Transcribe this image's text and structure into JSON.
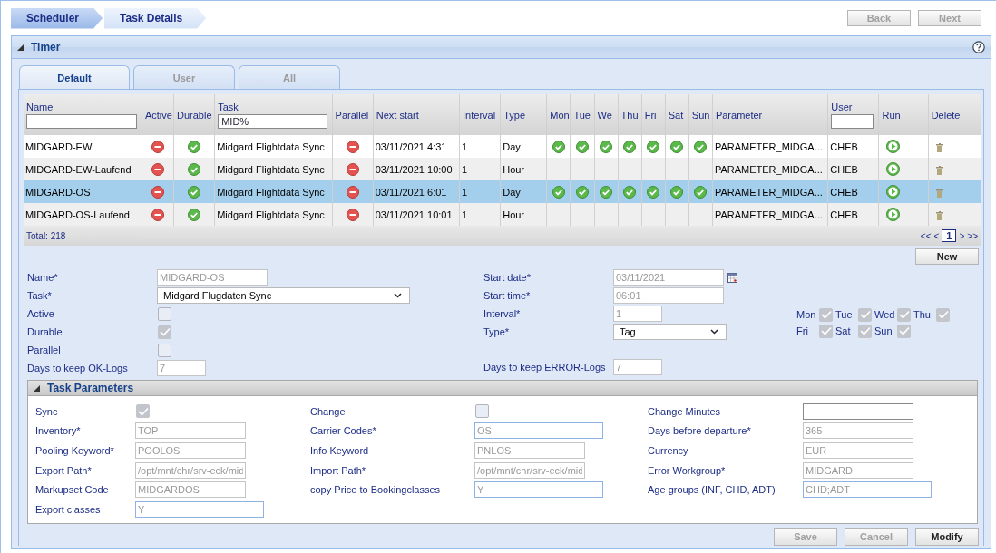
{
  "breadcrumb": [
    {
      "label": "Scheduler",
      "selected": true
    },
    {
      "label": "Task Details",
      "selected": false
    }
  ],
  "nav_buttons": [
    {
      "label": "Back",
      "disabled": true
    },
    {
      "label": "Next",
      "disabled": true
    }
  ],
  "panel": {
    "title": "Timer",
    "expanded": true
  },
  "tabs": [
    {
      "label": "Default",
      "selected": true
    },
    {
      "label": "User",
      "selected": false
    },
    {
      "label": "All",
      "selected": false
    }
  ],
  "table": {
    "columns": [
      {
        "label": "Name",
        "kind": "filter"
      },
      {
        "label": "Active",
        "kind": "plain"
      },
      {
        "label": "Durable",
        "kind": "plain"
      },
      {
        "label": "Task",
        "kind": "filter",
        "value": "MID%"
      },
      {
        "label": "Parallel",
        "kind": "plain"
      },
      {
        "label": "Next start",
        "kind": "plain"
      },
      {
        "label": "Interval",
        "kind": "plain"
      },
      {
        "label": "Type",
        "kind": "plain"
      },
      {
        "label": "Mon",
        "kind": "plain"
      },
      {
        "label": "Tue",
        "kind": "plain"
      },
      {
        "label": "We",
        "kind": "plain"
      },
      {
        "label": "Thu",
        "kind": "plain"
      },
      {
        "label": "Fri",
        "kind": "plain"
      },
      {
        "label": "Sat",
        "kind": "plain"
      },
      {
        "label": "Sun",
        "kind": "plain"
      },
      {
        "label": "Parameter",
        "kind": "plain"
      },
      {
        "label": "User",
        "kind": "filter"
      },
      {
        "label": "Run",
        "kind": "plain"
      },
      {
        "label": "Delete",
        "kind": "plain"
      }
    ],
    "rows": [
      {
        "name": "MIDGARD-EW",
        "active": false,
        "durable": true,
        "task": "Midgard Flightdata Sync",
        "parallel": false,
        "next_start": "03/11/2021 4:31",
        "interval": "1",
        "type": "Day",
        "days": [
          true,
          true,
          true,
          true,
          true,
          true,
          true
        ],
        "parameter": "PARAMETER_MIDGA...",
        "user": "CHEB",
        "selected": false
      },
      {
        "name": "MIDGARD-EW-Laufend",
        "active": false,
        "durable": true,
        "task": "Midgard Flightdata Sync",
        "parallel": false,
        "next_start": "03/11/2021 10:00",
        "interval": "1",
        "type": "Hour",
        "days": [
          false,
          false,
          false,
          false,
          false,
          false,
          false
        ],
        "parameter": "PARAMETER_MIDGA...",
        "user": "CHEB",
        "selected": false
      },
      {
        "name": "MIDGARD-OS",
        "active": false,
        "durable": true,
        "task": "Midgard Flightdata Sync",
        "parallel": false,
        "next_start": "03/11/2021 6:01",
        "interval": "1",
        "type": "Day",
        "days": [
          true,
          true,
          true,
          true,
          true,
          true,
          true
        ],
        "parameter": "PARAMETER_MIDGA...",
        "user": "CHEB",
        "selected": true
      },
      {
        "name": "MIDGARD-OS-Laufend",
        "active": false,
        "durable": true,
        "task": "Midgard Flightdata Sync",
        "parallel": false,
        "next_start": "03/11/2021 10:01",
        "interval": "1",
        "type": "Hour",
        "days": [
          false,
          false,
          false,
          false,
          false,
          false,
          false
        ],
        "parameter": "PARAMETER_MIDGA...",
        "user": "CHEB",
        "selected": false
      }
    ],
    "total": "Total: 218",
    "pager": [
      {
        "label": "<<",
        "selected": false
      },
      {
        "label": "<",
        "selected": false
      },
      {
        "label": "1",
        "selected": true
      },
      {
        "label": ">",
        "selected": false
      },
      {
        "label": ">>",
        "selected": false
      }
    ]
  },
  "new_button": "New",
  "form_left": [
    {
      "label": "Name*",
      "kind": "text",
      "value": "MIDGARD-OS"
    },
    {
      "label": "Task*",
      "kind": "select",
      "value": "Midgard Flugdaten Sync"
    },
    {
      "label": "Active",
      "kind": "checkbox",
      "checked": false
    },
    {
      "label": "Durable",
      "kind": "checkbox",
      "checked": true
    },
    {
      "label": "Parallel",
      "kind": "checkbox",
      "checked": false
    },
    {
      "label": "Days to keep OK-Logs",
      "kind": "number",
      "value": "7"
    }
  ],
  "form_right": [
    {
      "label": "Start date*",
      "kind": "date",
      "value": "03/11/2021"
    },
    {
      "label": "Start time*",
      "kind": "text",
      "value": "06:01"
    },
    {
      "label": "Interval*",
      "kind": "number",
      "value": "1"
    },
    {
      "label": "Type*",
      "kind": "select",
      "value": "Tag"
    },
    {
      "label": "Days to keep ERROR-Logs",
      "kind": "number",
      "value": "7"
    }
  ],
  "weekdays": [
    {
      "label": "Mon",
      "checked": true
    },
    {
      "label": "Tue",
      "checked": true
    },
    {
      "label": "Wed",
      "checked": true
    },
    {
      "label": "Thu",
      "checked": true
    },
    {
      "label": "Fri",
      "checked": true
    },
    {
      "label": "Sat",
      "checked": true
    },
    {
      "label": "Sun",
      "checked": true
    }
  ],
  "task_parameters": {
    "title": "Task Parameters",
    "expanded": true,
    "columns": [
      [
        {
          "label": "Sync",
          "kind": "checkbox",
          "checked": true
        },
        {
          "label": "Inventory*",
          "kind": "text",
          "value": "TOP",
          "editable": false
        },
        {
          "label": "Pooling Keyword*",
          "kind": "text",
          "value": "POOLOS",
          "editable": false
        },
        {
          "label": "Export Path*",
          "kind": "text",
          "value": "/opt/mnt/chr/srv-eck/mid",
          "editable": false
        },
        {
          "label": "Markupset Code",
          "kind": "text",
          "value": "MIDGARDOS",
          "editable": false
        },
        {
          "label": "Export classes",
          "kind": "text",
          "value": "Y",
          "editable": true
        }
      ],
      [
        {
          "label": "Change",
          "kind": "checkbox",
          "checked": false
        },
        {
          "label": "Carrier Codes*",
          "kind": "text",
          "value": "OS",
          "editable": true
        },
        {
          "label": "Info Keyword",
          "kind": "text",
          "value": "PNLOS",
          "editable": false
        },
        {
          "label": "Import Path*",
          "kind": "text",
          "value": "/opt/mnt/chr/srv-eck/mid",
          "editable": false
        },
        {
          "label": "copy Price to Bookingclasses",
          "kind": "text",
          "value": "Y",
          "editable": true
        }
      ],
      [
        {
          "label": "Change Minutes",
          "kind": "text",
          "editable": false
        },
        {
          "label": "Days before departure*",
          "kind": "text",
          "value": "365",
          "editable": false
        },
        {
          "label": "Currency",
          "kind": "text",
          "value": "EUR",
          "editable": false
        },
        {
          "label": "Error Workgroup*",
          "kind": "text",
          "value": "MIDGARD",
          "editable": false
        },
        {
          "label": "Age groups (INF, CHD, ADT)",
          "kind": "text",
          "value": "CHD;ADT",
          "editable": true
        }
      ]
    ]
  },
  "action_buttons": [
    {
      "label": "Save",
      "disabled": true
    },
    {
      "label": "Cancel",
      "disabled": true
    },
    {
      "label": "Modify",
      "disabled": false
    }
  ]
}
